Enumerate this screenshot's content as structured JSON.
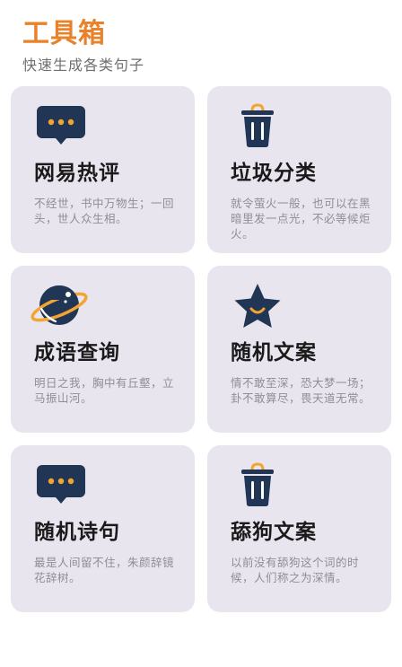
{
  "header": {
    "title": "工具箱",
    "subtitle": "快速生成各类句子"
  },
  "colors": {
    "title": "#e8822b",
    "subtitle": "#6f6f6f",
    "card_bg": "#e8e5ee",
    "card_title": "#1a1a1a",
    "card_desc": "#8e8e94",
    "icon_navy": "#213554",
    "icon_orange": "#f3a534"
  },
  "cards": [
    {
      "title": "网易热评",
      "desc": "不经世，书中万物生；一回头，世人众生相。",
      "icon": "chat-bubble-icon"
    },
    {
      "title": "垃圾分类",
      "desc": "就令萤火一般，也可以在黑暗里发一点光，不必等候炬火。",
      "icon": "trash-bin-icon"
    },
    {
      "title": "成语查询",
      "desc": "明日之我，胸中有丘壑，立马振山河。",
      "icon": "planet-icon"
    },
    {
      "title": "随机文案",
      "desc": "情不敢至深，恐大梦一场；卦不敢算尽，畏天道无常。",
      "icon": "star-icon"
    },
    {
      "title": "随机诗句",
      "desc": "最是人间留不住，朱颜辞镜花辞树。",
      "icon": "chat-bubble-icon"
    },
    {
      "title": "舔狗文案",
      "desc": "以前没有舔狗这个词的时候，人们称之为深情。",
      "icon": "trash-bin-icon"
    }
  ]
}
